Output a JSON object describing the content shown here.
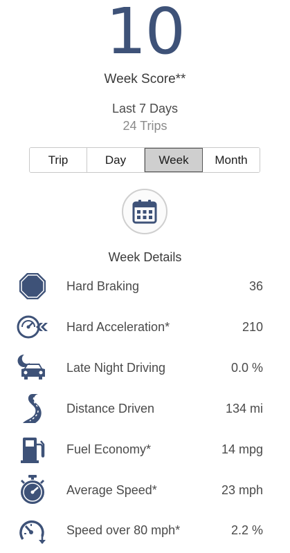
{
  "score": {
    "value": "10",
    "label": "Week Score**",
    "range": "Last 7 Days",
    "trips": "24 Trips"
  },
  "tabs": [
    {
      "label": "Trip",
      "active": false
    },
    {
      "label": "Day",
      "active": false
    },
    {
      "label": "Week",
      "active": true
    },
    {
      "label": "Month",
      "active": false
    }
  ],
  "calendar_icon": "calendar-icon",
  "details": {
    "title": "Week Details",
    "rows": [
      {
        "icon": "stop-sign-icon",
        "label": "Hard Braking",
        "value": "36"
      },
      {
        "icon": "speedometer-arrows-icon",
        "label": "Hard Acceleration*",
        "value": "210"
      },
      {
        "icon": "moon-car-icon",
        "label": "Late Night Driving",
        "value": "0.0 %"
      },
      {
        "icon": "winding-road-icon",
        "label": "Distance Driven",
        "value": "134 mi"
      },
      {
        "icon": "fuel-pump-icon",
        "label": "Fuel Economy*",
        "value": "14 mpg"
      },
      {
        "icon": "stopwatch-gauge-icon",
        "label": "Average Speed*",
        "value": "23 mph"
      },
      {
        "icon": "speed-gauge-arrow-icon",
        "label": "Speed over 80 mph*",
        "value": "2.2 %"
      }
    ]
  },
  "colors": {
    "accent": "#3e5278",
    "text": "#4a4a4a",
    "muted": "#8a8a8a",
    "active_tab": "#cfcfcf"
  }
}
